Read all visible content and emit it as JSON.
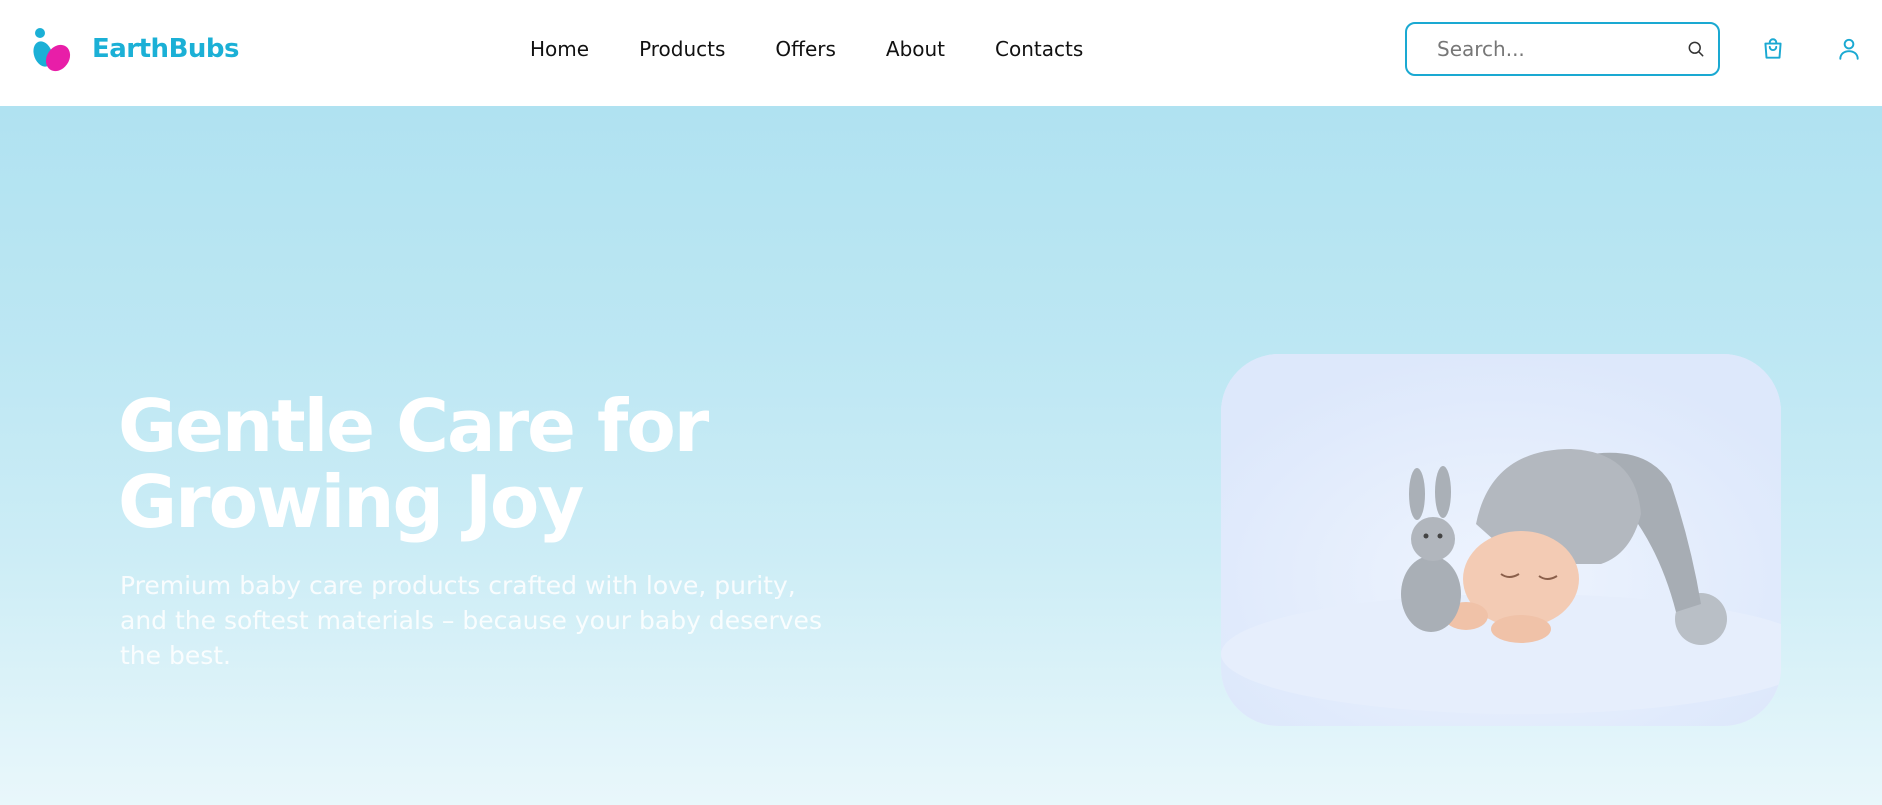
{
  "brand": {
    "name": "EarthBubs",
    "logo_icon": "earthbubs-logo-icon",
    "colors": {
      "primary": "#1bb0d6",
      "secondary": "#e81ea8"
    }
  },
  "nav": {
    "items": [
      {
        "label": "Home"
      },
      {
        "label": "Products"
      },
      {
        "label": "Offers"
      },
      {
        "label": "About"
      },
      {
        "label": "Contacts"
      }
    ]
  },
  "search": {
    "placeholder": "Search...",
    "icon": "search-icon"
  },
  "header_icons": {
    "cart": "shopping-bag-icon",
    "user": "user-icon"
  },
  "hero": {
    "title": "Gentle Care for Growing Joy",
    "subtitle": "Premium baby care products crafted with love, purity, and the softest materials – because your baby deserves the best.",
    "image_icon": "sleeping-baby-image"
  }
}
